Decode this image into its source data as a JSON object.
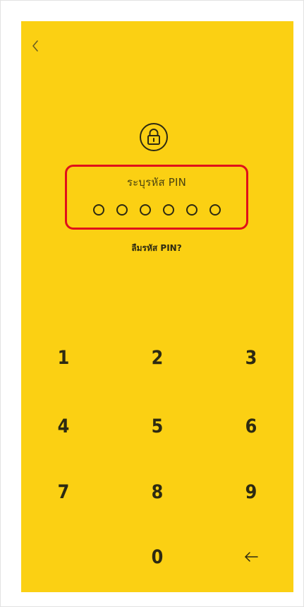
{
  "pin_prompt": {
    "label": "ระบุรหัส PIN",
    "length": 6,
    "filled": 0,
    "forgot_link": "ลืมรหัส PIN?"
  },
  "keypad": {
    "keys": [
      "1",
      "2",
      "3",
      "4",
      "5",
      "6",
      "7",
      "8",
      "9",
      "0"
    ]
  },
  "icons": {
    "back": "chevron-left-icon",
    "lock": "lock-icon",
    "backspace": "arrow-left-icon"
  },
  "colors": {
    "background": "#fbd013",
    "text": "#2d2a12",
    "highlight": "#e0101a"
  }
}
